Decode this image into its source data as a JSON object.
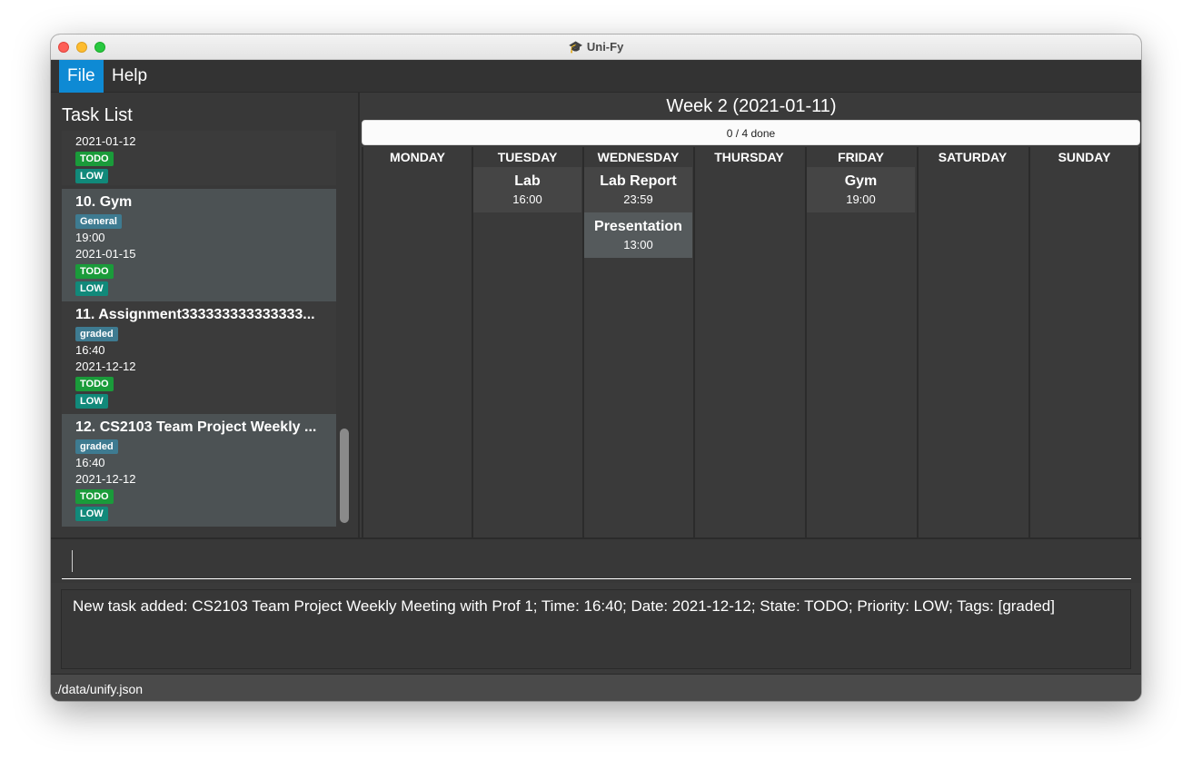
{
  "window": {
    "title": "Uni-Fy"
  },
  "menu": {
    "items": [
      "File",
      "Help"
    ],
    "active": "File"
  },
  "task_list": {
    "title": "Task List",
    "tasks": [
      {
        "name": "",
        "tags": [],
        "time": "",
        "date": "2021-01-12",
        "state": "TODO",
        "priority": "LOW"
      },
      {
        "name": "10.  Gym",
        "tags": [
          "General"
        ],
        "time": "19:00",
        "date": "2021-01-15",
        "state": "TODO",
        "priority": "LOW"
      },
      {
        "name": "11.  Assignment333333333333333...",
        "tags": [
          "graded"
        ],
        "time": "16:40",
        "date": "2021-12-12",
        "state": "TODO",
        "priority": "LOW"
      },
      {
        "name": "12.  CS2103 Team Project Weekly ...",
        "tags": [
          "graded"
        ],
        "time": "16:40",
        "date": "2021-12-12",
        "state": "TODO",
        "priority": "LOW"
      }
    ]
  },
  "calendar": {
    "week_title": "Week 2 (2021-01-11)",
    "progress": {
      "text": "0 / 4 done",
      "fraction": 0
    },
    "days": [
      {
        "name": "MONDAY",
        "events": []
      },
      {
        "name": "TUESDAY",
        "events": [
          {
            "name": "Lab",
            "time": "16:00"
          }
        ]
      },
      {
        "name": "WEDNESDAY",
        "events": [
          {
            "name": "Lab Report",
            "time": "23:59"
          },
          {
            "name": "Presentation",
            "time": "13:00"
          }
        ]
      },
      {
        "name": "THURSDAY",
        "events": []
      },
      {
        "name": "FRIDAY",
        "events": [
          {
            "name": "Gym",
            "time": "19:00"
          }
        ]
      },
      {
        "name": "SATURDAY",
        "events": []
      },
      {
        "name": "SUNDAY",
        "events": []
      }
    ]
  },
  "command": {
    "value": ""
  },
  "result": {
    "text": "New task added: CS2103 Team Project Weekly Meeting with Prof 1; Time: 16:40; Date: 2021-12-12; State: TODO; Priority: LOW; Tags: [graded]"
  },
  "status": {
    "file_path": "./data/unify.json"
  },
  "colors": {
    "accent": "#0e8ad4",
    "todo": "#1a9b3a",
    "low": "#11897a",
    "tag": "#3e7b91"
  }
}
